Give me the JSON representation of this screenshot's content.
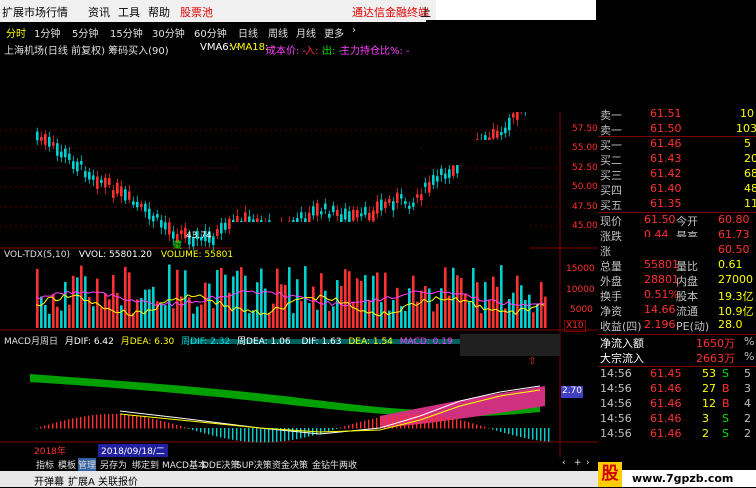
{
  "menu": {
    "items": [
      "扩展市场行情",
      "资讯",
      "工具",
      "帮助"
    ],
    "highlight": "股票池",
    "banner": "通达信金融终端",
    "banner_tail": "上"
  },
  "period_tabs": [
    "分时",
    "1分钟",
    "5分钟",
    "15分钟",
    "30分钟",
    "60分钟",
    "日线",
    "周线",
    "月线",
    "更多"
  ],
  "period_more_icon": "chevron-right-icon",
  "header_info": {
    "title": "上海机场(日线 前复权) 筹码买入(90)",
    "vma6": "VMA6: -",
    "vma18": "VMA18: -",
    "cost": "成本价: -",
    "in": "入: -",
    "out": "出: -",
    "holding": "主力持仓比%: -"
  },
  "price_axis": [
    "57.50",
    "55.00",
    "52.50",
    "50.00",
    "47.50",
    "45.00"
  ],
  "low_label": "43.74",
  "low_tag": "藏",
  "volume": {
    "header_name": "VOL-TDX(5,10)",
    "vvol": "VVOL: 55801.20",
    "volume": "VOLUME: 55801",
    "axis": [
      "15000",
      "10000",
      "5000"
    ],
    "unit": "X10"
  },
  "macd": {
    "header_name": "MACD月周日",
    "month_dif": "月DIF: 6.42",
    "month_dea": "月DEA: 6.30",
    "week_dif": "周DIF: 2.32",
    "week_dea": "周DEA: 1.06",
    "dif": "DIF: 1.63",
    "dea": "DEA: 1.54",
    "macd": "MACD: 0.19",
    "value_tag": "2.70"
  },
  "time_axis": {
    "year": "2018年",
    "cursor_date": "2018/09/18/二"
  },
  "bottom_tabs": [
    "指标",
    "模板",
    "管理",
    "另存为",
    "绑定到",
    "MACD基本",
    "DDE决策",
    "SUP决策",
    "资金决策",
    "金钻牛两收"
  ],
  "bottom_bar2": [
    "开弹幕",
    "扩展A",
    "关联报价"
  ],
  "order_book": {
    "sell": [
      {
        "label": "卖一",
        "price": "61.50",
        "vol": "103"
      }
    ],
    "buy": [
      {
        "label": "买一",
        "price": "61.46",
        "vol": "5"
      },
      {
        "label": "买二",
        "price": "61.43",
        "vol": "20"
      },
      {
        "label": "买三",
        "price": "61.42",
        "vol": "68"
      },
      {
        "label": "买四",
        "price": "61.40",
        "vol": "48"
      },
      {
        "label": "买五",
        "price": "61.35",
        "vol": "11"
      }
    ]
  },
  "stats": [
    {
      "label": "现价",
      "value": "61.50",
      "label2": "今开",
      "value2": "60.80"
    },
    {
      "label": "涨跌",
      "value": "0.44",
      "label2": "最高",
      "value2": "61.73"
    },
    {
      "label": "涨",
      "value": "",
      "label2": "",
      "value2": "60.50"
    },
    {
      "label": "总量",
      "value": "55801",
      "label2": "量比",
      "value2": "0.61"
    },
    {
      "label": "外盘",
      "value": "28801",
      "label2": "内盘",
      "value2": "27000"
    },
    {
      "label": "换手",
      "value": "0.51%",
      "label2": "股本",
      "value2": "19.3亿"
    },
    {
      "label": "净资",
      "value": "14.66",
      "label2": "流通",
      "value2": "10.9亿"
    },
    {
      "label": "收益(四)",
      "value": "2.196",
      "label2": "PE(动)",
      "value2": "28.0"
    }
  ],
  "flow": [
    {
      "label": "净流入额",
      "value": "1650万",
      "pct": "%"
    },
    {
      "label": "大宗流入",
      "value": "2663万",
      "pct": "%"
    }
  ],
  "ticks": [
    {
      "time": "14:56",
      "price": "61.45",
      "vol": "53",
      "side": "S",
      "n": "5"
    },
    {
      "time": "14:56",
      "price": "61.46",
      "vol": "27",
      "side": "B",
      "n": "3"
    },
    {
      "time": "14:56",
      "price": "61.46",
      "vol": "12",
      "side": "B",
      "n": "4"
    },
    {
      "time": "14:56",
      "price": "61.46",
      "vol": "3",
      "side": "S",
      "n": "2"
    },
    {
      "time": "14:56",
      "price": "61.46",
      "vol": "2",
      "side": "S",
      "n": "2"
    }
  ],
  "top_right_partial": {
    "label": "卖一",
    "price": "61.51",
    "vol": "10"
  },
  "watermark": "www.7gpzb.com",
  "logo_char": "股"
}
